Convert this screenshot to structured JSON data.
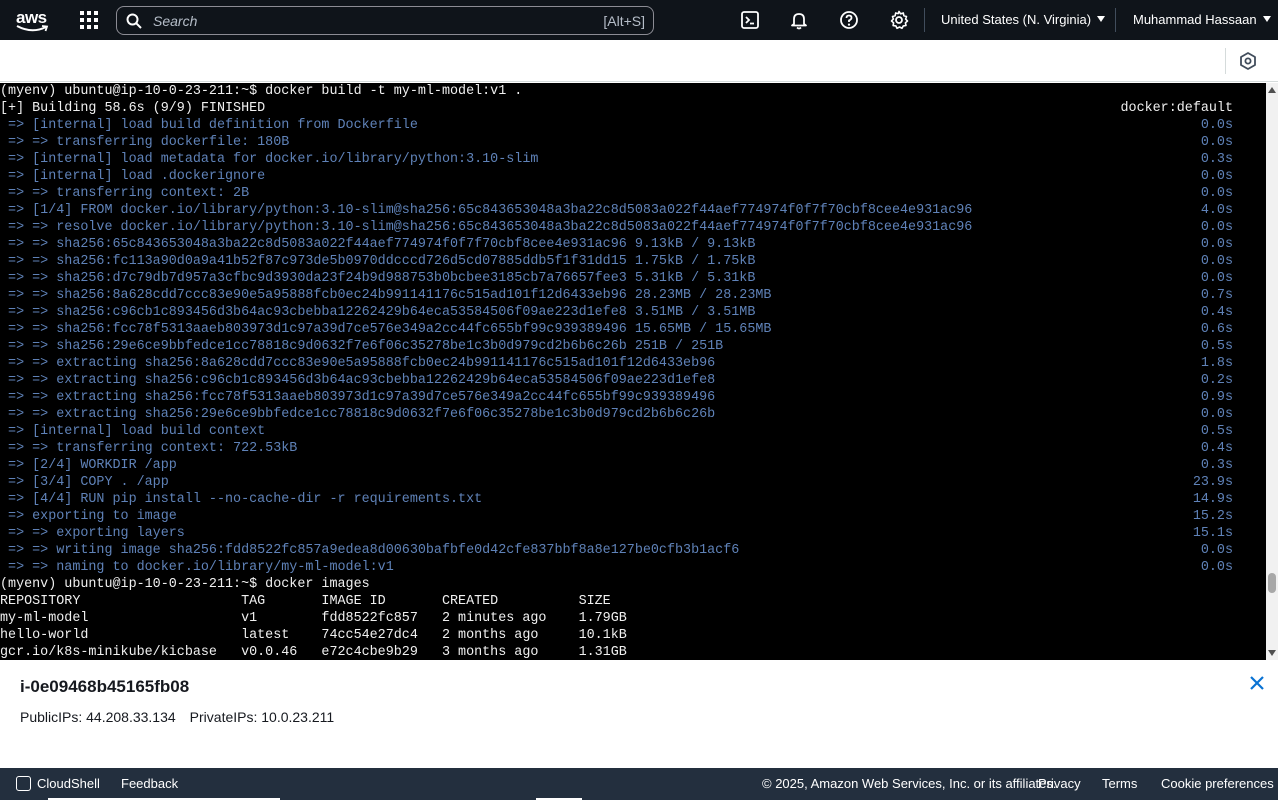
{
  "topnav": {
    "logo_text": "aws",
    "search_placeholder": "Search",
    "search_shortcut": "[Alt+S]",
    "region": "United States (N. Virginia)",
    "user": "Muhammad Hassaan",
    "icons": [
      "apps-grid-icon",
      "search-icon",
      "cloudshell-icon",
      "bell-icon",
      "help-icon",
      "gear-icon"
    ]
  },
  "terminal": {
    "lines": [
      {
        "text": "(myenv) ubuntu@ip-10-0-23-211:~$ docker build -t my-ml-model:v1 .",
        "right": "",
        "color": "white"
      },
      {
        "text": "[+] Building 58.6s (9/9) FINISHED",
        "right": "docker:default",
        "color": "white"
      },
      {
        "text": " => [internal] load build definition from Dockerfile",
        "right": "0.0s",
        "color": "blue"
      },
      {
        "text": " => => transferring dockerfile: 180B",
        "right": "0.0s",
        "color": "blue"
      },
      {
        "text": " => [internal] load metadata for docker.io/library/python:3.10-slim",
        "right": "0.3s",
        "color": "blue"
      },
      {
        "text": " => [internal] load .dockerignore",
        "right": "0.0s",
        "color": "blue"
      },
      {
        "text": " => => transferring context: 2B",
        "right": "0.0s",
        "color": "blue"
      },
      {
        "text": " => [1/4] FROM docker.io/library/python:3.10-slim@sha256:65c843653048a3ba22c8d5083a022f44aef774974f0f7f70cbf8cee4e931ac96",
        "right": "4.0s",
        "color": "blue"
      },
      {
        "text": " => => resolve docker.io/library/python:3.10-slim@sha256:65c843653048a3ba22c8d5083a022f44aef774974f0f7f70cbf8cee4e931ac96",
        "right": "0.0s",
        "color": "blue"
      },
      {
        "text": " => => sha256:65c843653048a3ba22c8d5083a022f44aef774974f0f7f70cbf8cee4e931ac96 9.13kB / 9.13kB",
        "right": "0.0s",
        "color": "blue"
      },
      {
        "text": " => => sha256:fc113a90d0a9a41b52f87c973de5b0970ddcccd726d5cd07885ddb5f1f31dd15 1.75kB / 1.75kB",
        "right": "0.0s",
        "color": "blue"
      },
      {
        "text": " => => sha256:d7c79db7d957a3cfbc9d3930da23f24b9d988753b0bcbee3185cb7a76657fee3 5.31kB / 5.31kB",
        "right": "0.0s",
        "color": "blue"
      },
      {
        "text": " => => sha256:8a628cdd7ccc83e90e5a95888fcb0ec24b991141176c515ad101f12d6433eb96 28.23MB / 28.23MB",
        "right": "0.7s",
        "color": "blue"
      },
      {
        "text": " => => sha256:c96cb1c893456d3b64ac93cbebba12262429b64eca53584506f09ae223d1efe8 3.51MB / 3.51MB",
        "right": "0.4s",
        "color": "blue"
      },
      {
        "text": " => => sha256:fcc78f5313aaeb803973d1c97a39d7ce576e349a2cc44fc655bf99c939389496 15.65MB / 15.65MB",
        "right": "0.6s",
        "color": "blue"
      },
      {
        "text": " => => sha256:29e6ce9bbfedce1cc78818c9d0632f7e6f06c35278be1c3b0d979cd2b6b6c26b 251B / 251B",
        "right": "0.5s",
        "color": "blue"
      },
      {
        "text": " => => extracting sha256:8a628cdd7ccc83e90e5a95888fcb0ec24b991141176c515ad101f12d6433eb96",
        "right": "1.8s",
        "color": "blue"
      },
      {
        "text": " => => extracting sha256:c96cb1c893456d3b64ac93cbebba12262429b64eca53584506f09ae223d1efe8",
        "right": "0.2s",
        "color": "blue"
      },
      {
        "text": " => => extracting sha256:fcc78f5313aaeb803973d1c97a39d7ce576e349a2cc44fc655bf99c939389496",
        "right": "0.9s",
        "color": "blue"
      },
      {
        "text": " => => extracting sha256:29e6ce9bbfedce1cc78818c9d0632f7e6f06c35278be1c3b0d979cd2b6b6c26b",
        "right": "0.0s",
        "color": "blue"
      },
      {
        "text": " => [internal] load build context",
        "right": "0.5s",
        "color": "blue"
      },
      {
        "text": " => => transferring context: 722.53kB",
        "right": "0.4s",
        "color": "blue"
      },
      {
        "text": " => [2/4] WORKDIR /app",
        "right": "0.3s",
        "color": "blue"
      },
      {
        "text": " => [3/4] COPY . /app",
        "right": "23.9s",
        "color": "blue"
      },
      {
        "text": " => [4/4] RUN pip install --no-cache-dir -r requirements.txt",
        "right": "14.9s",
        "color": "blue"
      },
      {
        "text": " => exporting to image",
        "right": "15.2s",
        "color": "blue"
      },
      {
        "text": " => => exporting layers",
        "right": "15.1s",
        "color": "blue"
      },
      {
        "text": " => => writing image sha256:fdd8522fc857a9edea8d00630bafbfe0d42cfe837bbf8a8e127be0cfb3b1acf6",
        "right": "0.0s",
        "color": "blue"
      },
      {
        "text": " => => naming to docker.io/library/my-ml-model:v1",
        "right": "0.0s",
        "color": "blue"
      },
      {
        "text": "(myenv) ubuntu@ip-10-0-23-211:~$ docker images",
        "right": "",
        "color": "white"
      },
      {
        "text": "REPOSITORY                    TAG       IMAGE ID       CREATED          SIZE",
        "right": "",
        "color": "white"
      },
      {
        "text": "my-ml-model                   v1        fdd8522fc857   2 minutes ago    1.79GB",
        "right": "",
        "color": "white"
      },
      {
        "text": "hello-world                   latest    74cc54e27dc4   2 months ago     10.1kB",
        "right": "",
        "color": "white"
      },
      {
        "text": "gcr.io/k8s-minikube/kicbase   v0.0.46   e72c4cbe9b29   3 months ago     1.31GB",
        "right": "",
        "color": "white"
      }
    ]
  },
  "instance": {
    "id": "i-0e09468b45165fb08",
    "public_ips": "PublicIPs: 44.208.33.134",
    "private_ips": "PrivateIPs: 10.0.23.211"
  },
  "footer": {
    "cloudshell": "CloudShell",
    "feedback": "Feedback",
    "copyright": "© 2025, Amazon Web Services, Inc. or its affiliates.",
    "privacy": "Privacy",
    "terms": "Terms",
    "cookie": "Cookie preferences"
  },
  "colors": {
    "nav_bg": "#0f141a",
    "footer_bg": "#232f3e",
    "terminal_bg": "#000000",
    "terminal_blue": "#5f82b8",
    "terminal_white": "#f0f0f0",
    "close_blue": "#0972d3"
  }
}
